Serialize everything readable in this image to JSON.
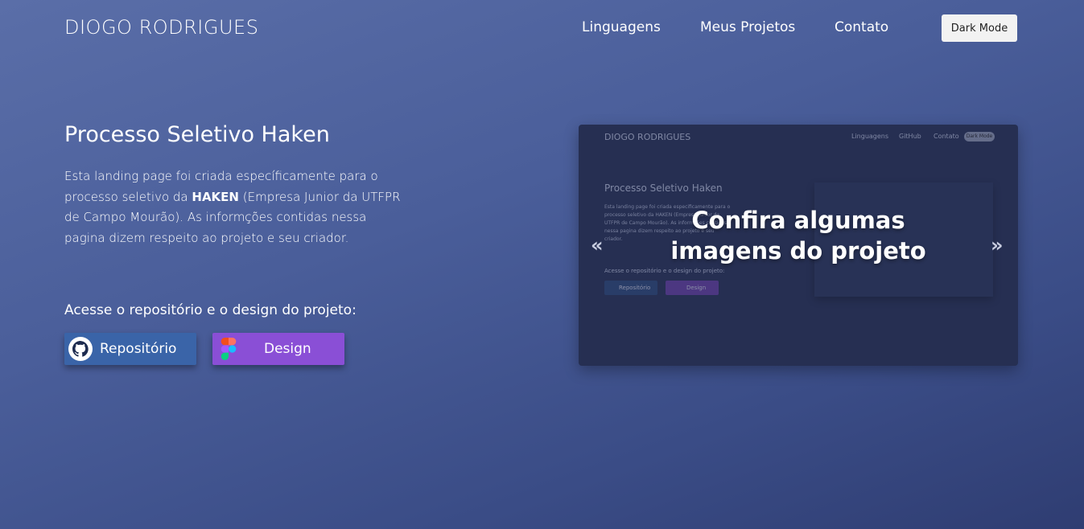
{
  "header": {
    "brand": "DIOGO RODRIGUES",
    "nav": [
      "Linguagens",
      "Meus Projetos",
      "Contato"
    ],
    "dark_mode_label": "Dark Mode"
  },
  "hero": {
    "title": "Processo Seletivo Haken",
    "description_before": "Esta landing page foi criada específicamente para o processo seletivo da ",
    "description_bold": "HAKEN",
    "description_after": " (Empresa Junior da UTFPR de Campo Mourão). As informções contidas nessa pagina dizem respeito ao projeto e seu criador.",
    "access_text": "Acesse o repositório e o design do projeto:",
    "repo_label": "Repositório",
    "design_label": "Design"
  },
  "carousel": {
    "caption_line1": "Confira algumas",
    "caption_line2": "imagens do projeto",
    "prev": "«",
    "next": "»",
    "preview": {
      "brand": "DIOGO RODRIGUES",
      "nav": [
        "Linguagens",
        "GitHub",
        "Contato"
      ],
      "dark_mode_label": "Dark Mode",
      "title": "Processo Seletivo Haken",
      "description": "Esta landing page foi criada especificamente para o processo seletivo da HAKEN (Empresa Junior da UTFPR de Campo Mourão). As informções contidas nessa pagina dizem respeito ao projeto e seu criador.",
      "access_text": "Acesse o repositório e o design do projeto:",
      "repo_label": "Repositório",
      "design_label": "Design"
    }
  },
  "colors": {
    "repo_button": "#3a64a8",
    "design_button": "#8a4fd6"
  }
}
